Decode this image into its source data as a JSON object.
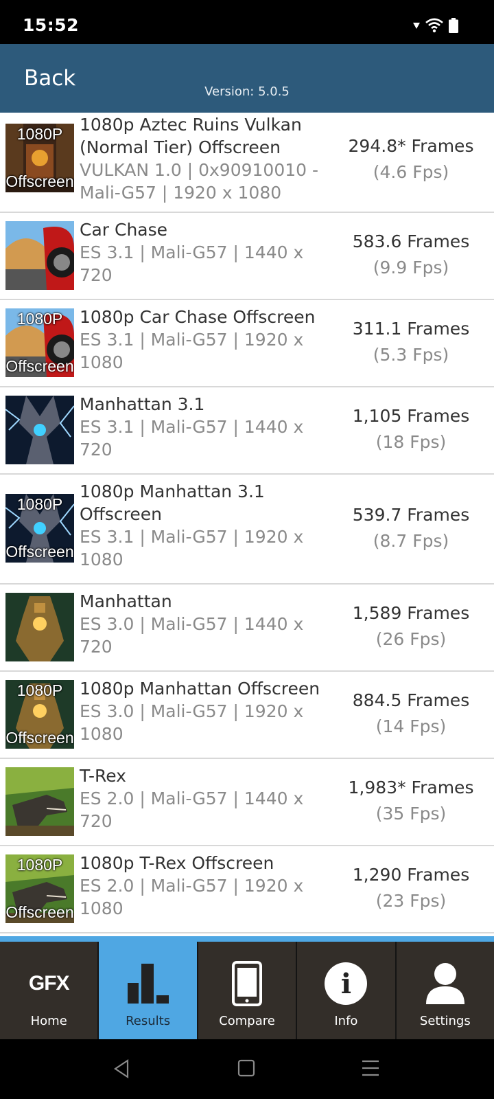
{
  "status": {
    "time": "15:52"
  },
  "header": {
    "back_label": "Back",
    "version": "Version: 5.0.5"
  },
  "results": [
    {
      "thumb_top": "1080P",
      "thumb_bottom": "Offscreen",
      "title": "1080p Aztec Ruins Vulkan (Normal Tier) Offscreen",
      "sub": "VULKAN 1.0 | 0x90910010 - Mali-G57 | 1920 x 1080",
      "frames": "294.8* Frames",
      "fps": "(4.6 Fps)"
    },
    {
      "thumb_top": "",
      "thumb_bottom": "",
      "title": "Car Chase",
      "sub": "ES 3.1 | Mali-G57 | 1440 x 720",
      "frames": "583.6 Frames",
      "fps": "(9.9 Fps)"
    },
    {
      "thumb_top": "1080P",
      "thumb_bottom": "Offscreen",
      "title": "1080p Car Chase Offscreen",
      "sub": "ES 3.1 | Mali-G57 | 1920 x 1080",
      "frames": "311.1 Frames",
      "fps": "(5.3 Fps)"
    },
    {
      "thumb_top": "",
      "thumb_bottom": "",
      "title": "Manhattan 3.1",
      "sub": "ES 3.1 | Mali-G57 | 1440 x 720",
      "frames": "1,105 Frames",
      "fps": "(18 Fps)"
    },
    {
      "thumb_top": "1080P",
      "thumb_bottom": "Offscreen",
      "title": "1080p Manhattan 3.1 Offscreen",
      "sub": "ES 3.1 | Mali-G57 | 1920 x 1080",
      "frames": "539.7 Frames",
      "fps": "(8.7 Fps)"
    },
    {
      "thumb_top": "",
      "thumb_bottom": "",
      "title": "Manhattan",
      "sub": "ES 3.0 | Mali-G57 | 1440 x 720",
      "frames": "1,589 Frames",
      "fps": "(26 Fps)"
    },
    {
      "thumb_top": "1080P",
      "thumb_bottom": "Offscreen",
      "title": "1080p Manhattan Offscreen",
      "sub": "ES 3.0 | Mali-G57 | 1920 x 1080",
      "frames": "884.5 Frames",
      "fps": "(14 Fps)"
    },
    {
      "thumb_top": "",
      "thumb_bottom": "",
      "title": "T-Rex",
      "sub": "ES 2.0 | Mali-G57 | 1440 x 720",
      "frames": "1,983* Frames",
      "fps": "(35 Fps)"
    },
    {
      "thumb_top": "1080P",
      "thumb_bottom": "Offscreen",
      "title": "1080p T-Rex Offscreen",
      "sub": "ES 2.0 | Mali-G57 | 1920 x 1080",
      "frames": "1,290 Frames",
      "fps": "(23 Fps)"
    }
  ],
  "tabs": {
    "home": {
      "label": "Home",
      "logo": "GFX"
    },
    "results": {
      "label": "Results"
    },
    "compare": {
      "label": "Compare"
    },
    "info": {
      "label": "Info",
      "glyph": "i"
    },
    "settings": {
      "label": "Settings"
    }
  },
  "colors": {
    "header": "#2d5a7b",
    "active_tab": "#4fa7e3",
    "tab_bg": "#332e29"
  }
}
